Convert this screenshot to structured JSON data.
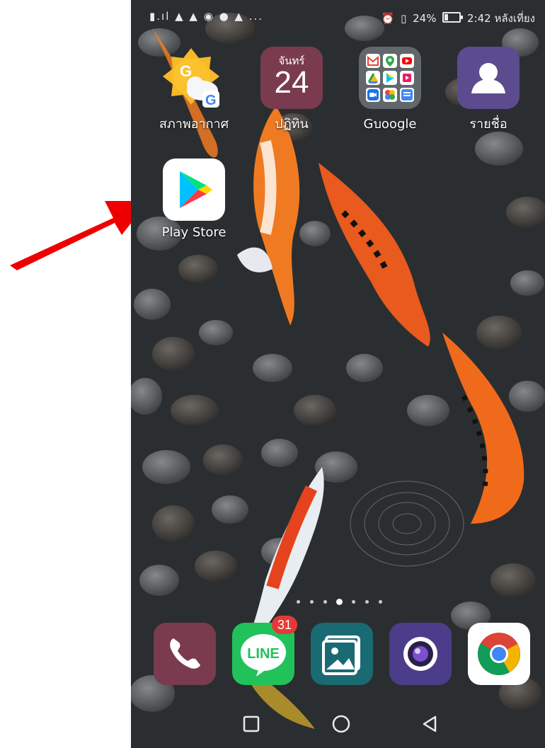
{
  "status": {
    "left_icons": "▮.ıl ▲ ▲ ◉ ● ▲ ...",
    "battery": "24%",
    "time": "2:42 หลังเที่ยง"
  },
  "apps": {
    "weather": "สภาพอากาศ",
    "calendar": {
      "label": "ปฏิทิน",
      "day": "จันทร์",
      "date": "24"
    },
    "google_folder": "Gบoogle",
    "contacts": "รายชื่อ",
    "play_store": "Play Store"
  },
  "dock": {
    "line_badge": "31",
    "line_text": "LINE"
  },
  "icons": {
    "arrow": "red-arrow-icon",
    "recent": "square-icon",
    "home": "circle-icon",
    "back": "triangle-back-icon"
  },
  "colors": {
    "arrow": "#ee0000",
    "badge": "#e53935"
  }
}
